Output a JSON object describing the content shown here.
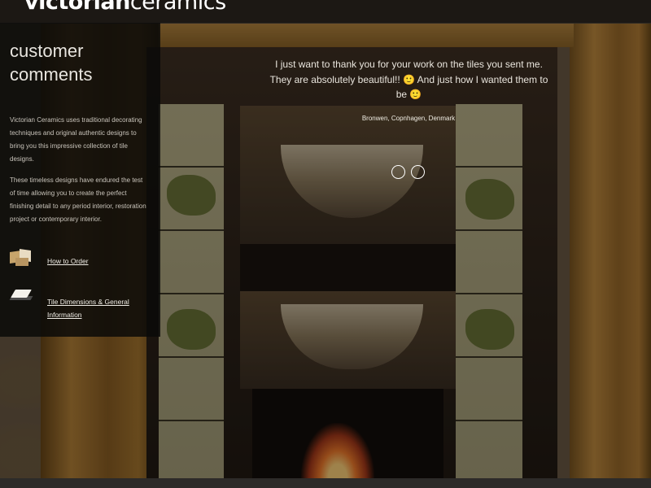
{
  "header": {
    "logo_bold": "victorian",
    "logo_light": "ceramics",
    "nav": [
      "",
      "",
      "",
      "",
      ""
    ]
  },
  "panel": {
    "title_line1": "customer",
    "title_line2": "comments",
    "paragraph1": "Victorian Ceramics uses traditional decorating techniques and original authentic designs to bring you this impressive collection of tile designs.",
    "paragraph2": "These timeless designs have endured the test of time allowing you to create the perfect finishing detail to any period interior, restoration project or contemporary interior.",
    "link1": "How to Order",
    "link2": "Tile Dimensions & General Information"
  },
  "testimonial": {
    "quote": "I just want to thank you for your work on the tiles you sent me. They are absolutely beautiful!! 🙂 And just how I wanted them to be 🙂",
    "author": "Bronwen, Copnhagen, Denmark"
  },
  "colors": {
    "panel_bg": "#0a0908",
    "text": "#e9e5dd"
  }
}
